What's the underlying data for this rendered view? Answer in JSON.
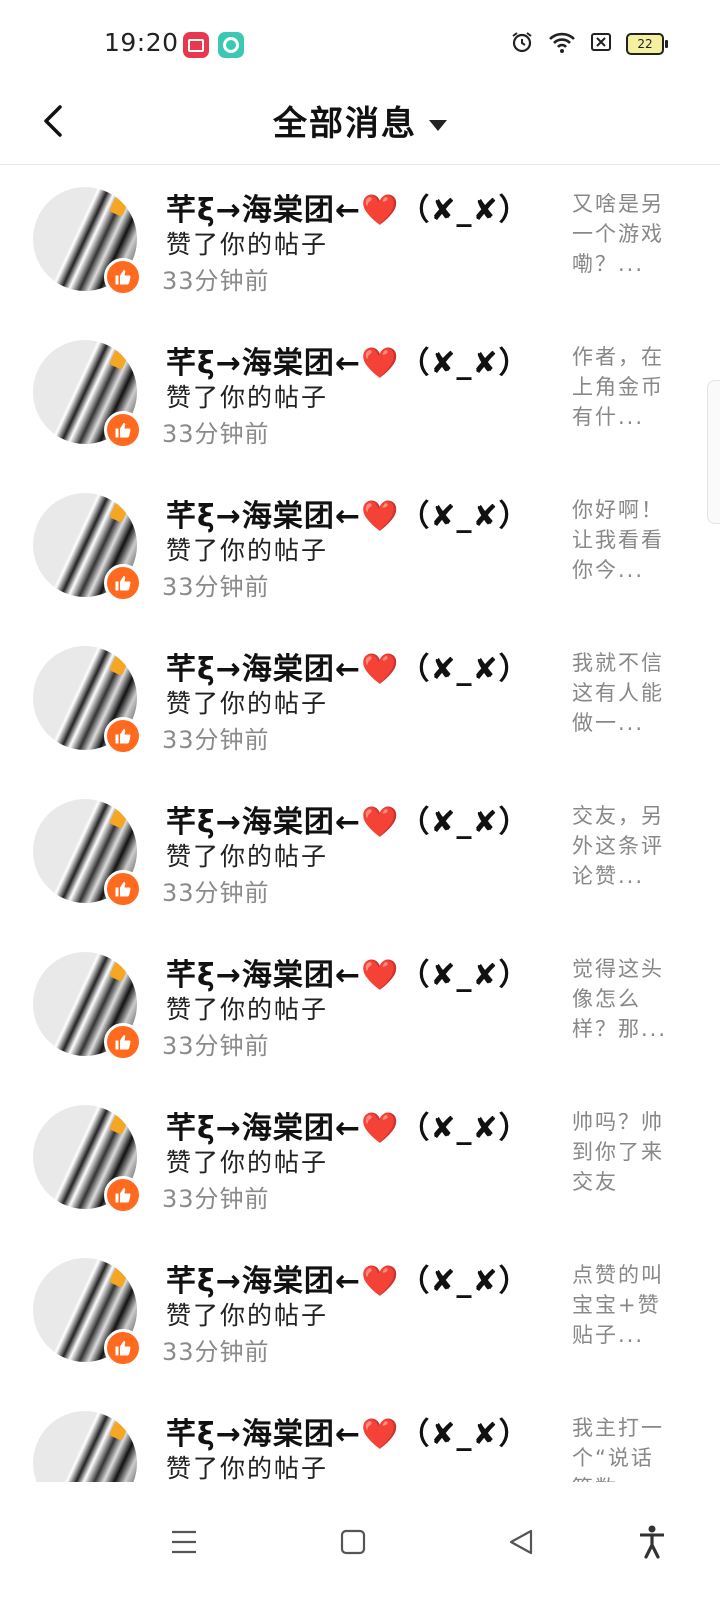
{
  "status_bar": {
    "time": "19:20",
    "battery_level": "22",
    "colors": {
      "red_badge": "#e8384f",
      "teal_badge": "#3cc8b4"
    },
    "icons": [
      "screen-record-icon",
      "app-notification-icon",
      "alarm-icon",
      "wifi-icon",
      "no-sim-icon",
      "battery-icon"
    ]
  },
  "header": {
    "title": "全部消息",
    "back_icon": "chevron-left-icon",
    "dropdown_icon": "caret-down-icon"
  },
  "notifications": [
    {
      "nickname": "芊ξ→海棠团←❤️（✘_✘）",
      "action": "赞了你的帖子",
      "time": "33分钟前",
      "preview": "又啥是另一个游戏嘞？..."
    },
    {
      "nickname": "芊ξ→海棠团←❤️（✘_✘）",
      "action": "赞了你的帖子",
      "time": "33分钟前",
      "preview": "作者，在上角金币有什..."
    },
    {
      "nickname": "芊ξ→海棠团←❤️（✘_✘）",
      "action": "赞了你的帖子",
      "time": "33分钟前",
      "preview": "你好啊！让我看看你今..."
    },
    {
      "nickname": "芊ξ→海棠团←❤️（✘_✘）",
      "action": "赞了你的帖子",
      "time": "33分钟前",
      "preview": "我就不信这有人能做一..."
    },
    {
      "nickname": "芊ξ→海棠团←❤️（✘_✘）",
      "action": "赞了你的帖子",
      "time": "33分钟前",
      "preview": "交友，另外这条评论赞..."
    },
    {
      "nickname": "芊ξ→海棠团←❤️（✘_✘）",
      "action": "赞了你的帖子",
      "time": "33分钟前",
      "preview": "觉得这头像怎么样？那..."
    },
    {
      "nickname": "芊ξ→海棠团←❤️（✘_✘）",
      "action": "赞了你的帖子",
      "time": "33分钟前",
      "preview": "帅吗？帅到你了来交友"
    },
    {
      "nickname": "芊ξ→海棠团←❤️（✘_✘）",
      "action": "赞了你的帖子",
      "time": "33分钟前",
      "preview": "点赞的叫宝宝+赞贴子..."
    },
    {
      "nickname": "芊ξ→海棠团←❤️（✘_✘）",
      "action": "赞了你的帖子",
      "time": "",
      "preview": "我主打一个“说话算数"
    }
  ],
  "like_badge_color": "#ff6a1f",
  "nav_bar": {
    "icons": [
      "menu-icon",
      "home-square-icon",
      "back-triangle-icon",
      "accessibility-icon"
    ]
  }
}
